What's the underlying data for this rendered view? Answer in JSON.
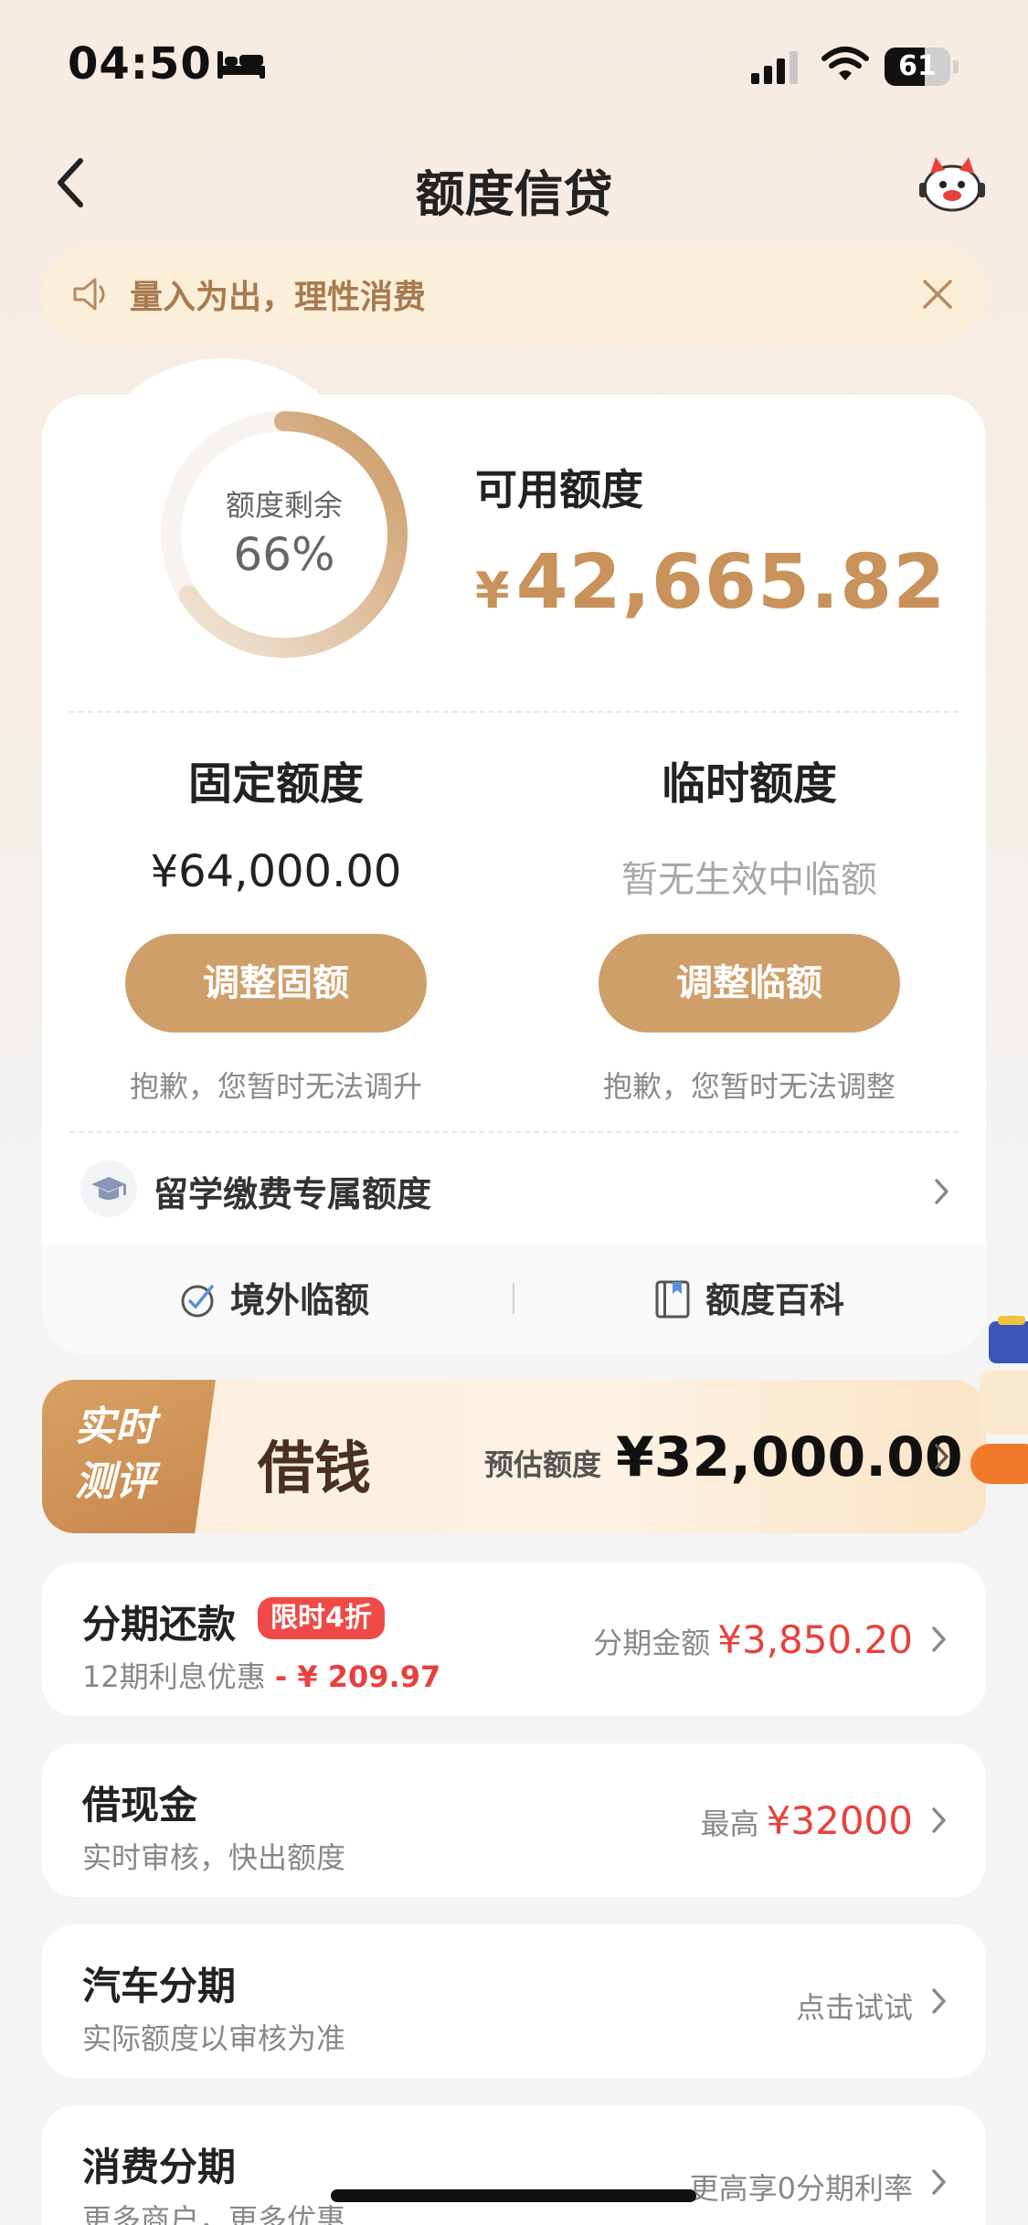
{
  "status_bar": {
    "time": "04:50",
    "battery": "61",
    "battery_level": 0.61
  },
  "nav": {
    "title": "额度信贷"
  },
  "notice": {
    "text": "量入为出，理性消费"
  },
  "credit": {
    "ring_label": "额度剩余",
    "ring_percent": "66%",
    "ring_fraction": 0.66,
    "available_label": "可用额度",
    "available_currency": "¥",
    "available_amount": "42,665.82",
    "fixed": {
      "title": "固定额度",
      "value": "¥64,000.00",
      "button": "调整固额",
      "note": "抱歉，您暂时无法调升"
    },
    "temp": {
      "title": "临时额度",
      "value": "暂无生效中临额",
      "button": "调整临额",
      "note": "抱歉，您暂时无法调整"
    },
    "study_label": "留学缴费专属额度",
    "footer": {
      "overseas": "境外临额",
      "wiki": "额度百科"
    }
  },
  "borrow": {
    "tag_line1": "实时",
    "tag_line2": "测评",
    "title": "借钱",
    "estimate_label": "预估额度",
    "estimate_amount": "¥32,000.00"
  },
  "items": [
    {
      "title": "分期还款",
      "badge": "限时4折",
      "sub": "12期利息优惠",
      "sub_red": "- ¥ 209.97",
      "right_label": "分期金额",
      "right_value": "¥3,850.20"
    },
    {
      "title": "借现金",
      "sub": "实时审核，快出额度",
      "right_label": "最高",
      "right_value": "¥32000"
    },
    {
      "title": "汽车分期",
      "sub": "实际额度以审核为准",
      "right_label": "点击试试"
    },
    {
      "title": "消费分期",
      "sub": "更多商户，更多优惠",
      "right_label": "更高享0分期利率"
    }
  ],
  "colors": {
    "accent": "#cf9f6a",
    "gold_text": "#c9925b",
    "red": "#e8413d"
  }
}
